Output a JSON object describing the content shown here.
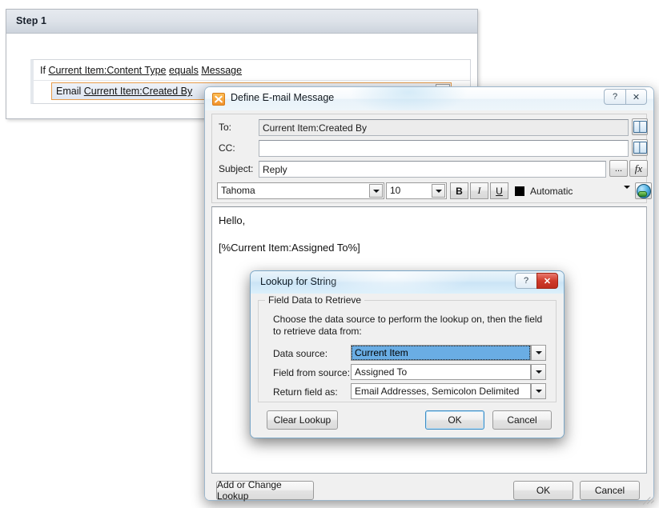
{
  "workflow": {
    "step_title": "Step 1",
    "condition": {
      "keyword": "If",
      "field": "Current Item:Content Type",
      "operator": "equals",
      "value": "Message"
    },
    "action": {
      "keyword": "Email",
      "target": "Current Item:Created By"
    }
  },
  "email_dialog": {
    "title": "Define E-mail Message",
    "app_icon": "sharepoint-designer-icon",
    "caption_buttons": {
      "help": "?",
      "close": "✕"
    },
    "fields": {
      "to_label": "To:",
      "to_value": "Current Item:Created By",
      "cc_label": "CC:",
      "cc_value": "",
      "subject_label": "Subject:",
      "subject_value": "Reply",
      "browse_label": "...",
      "fx_label": "fx",
      "addressbook_icon": "address-book-icon"
    },
    "toolbar": {
      "font_family": "Tahoma",
      "font_size": "10",
      "bold": "B",
      "italic": "I",
      "underline": "U",
      "color_label": "Automatic",
      "color_swatch": "#000000",
      "hyperlink_icon": "hyperlink-globe-icon"
    },
    "message_body": [
      "Hello,",
      "[%Current Item:Assigned To%]"
    ],
    "footer": {
      "add_or_change_lookup": "Add or Change Lookup",
      "ok": "OK",
      "cancel": "Cancel"
    }
  },
  "lookup_dialog": {
    "title": "Lookup for String",
    "caption_buttons": {
      "help": "?",
      "close": "✕"
    },
    "group_legend": "Field Data to Retrieve",
    "instructions": "Choose the data source to perform the lookup on, then the field to retrieve data from:",
    "rows": [
      {
        "label": "Data source:",
        "value": "Current Item"
      },
      {
        "label": "Field from source:",
        "value": "Assigned To"
      },
      {
        "label": "Return field as:",
        "value": "Email Addresses, Semicolon Delimited"
      }
    ],
    "buttons": {
      "clear_lookup": "Clear Lookup",
      "ok": "OK",
      "cancel": "Cancel"
    }
  }
}
